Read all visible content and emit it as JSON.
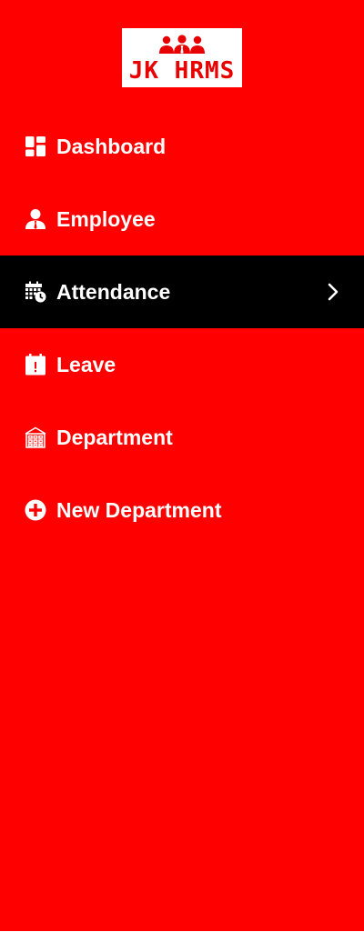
{
  "app": {
    "logo_text": "JK HRMS",
    "logo_icon": "people-group-icon",
    "brand_color": "#fe0000",
    "active_bg": "#000000",
    "text_color": "#ffffff"
  },
  "sidebar": {
    "items": [
      {
        "label": "Dashboard",
        "icon": "dashboard-icon",
        "active": false
      },
      {
        "label": "Employee",
        "icon": "employee-icon",
        "active": false
      },
      {
        "label": "Attendance",
        "icon": "calendar-clock-icon",
        "active": true
      },
      {
        "label": "Leave",
        "icon": "calendar-alert-icon",
        "active": false
      },
      {
        "label": "Department",
        "icon": "building-icon",
        "active": false
      },
      {
        "label": "New Department",
        "icon": "plus-circle-icon",
        "active": false
      }
    ]
  }
}
